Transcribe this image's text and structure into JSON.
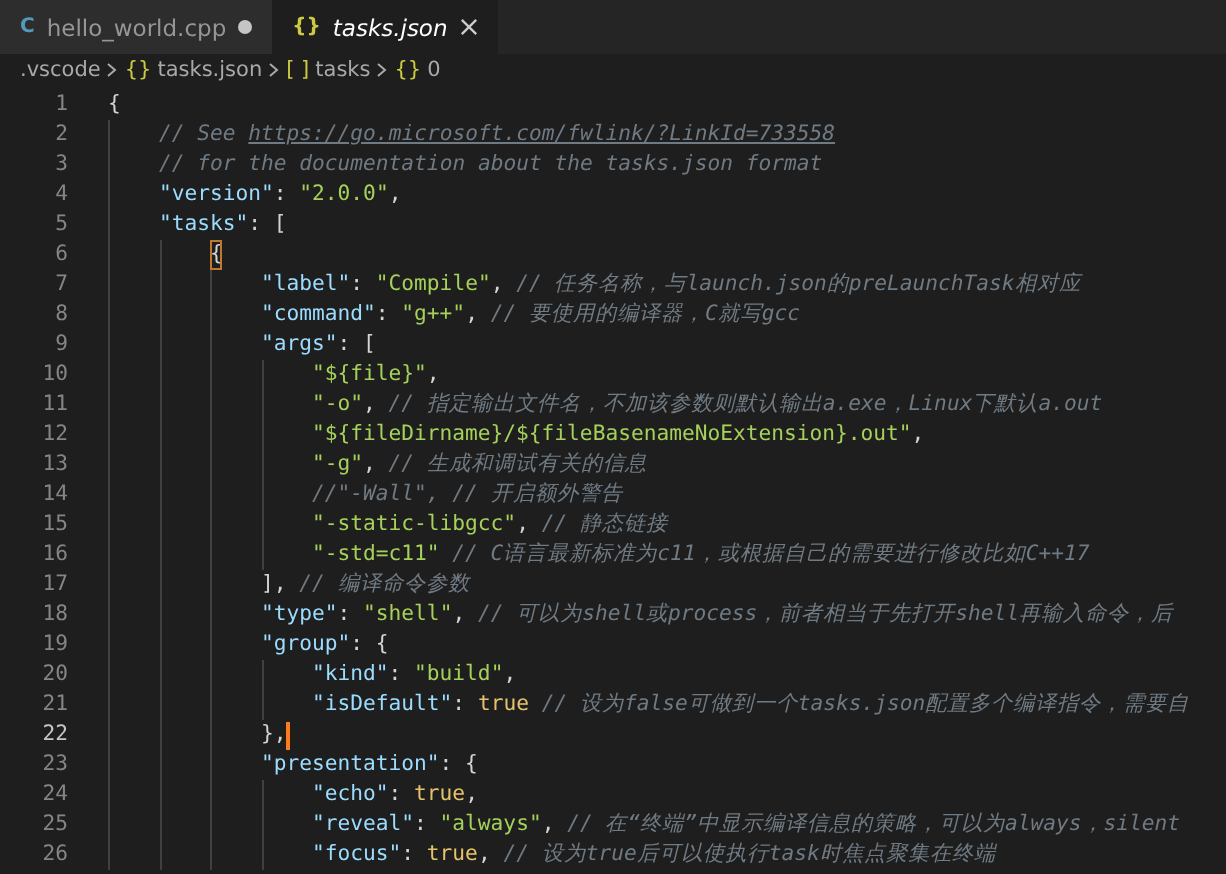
{
  "tabs": [
    {
      "icon": "C",
      "label": "hello_world.cpp",
      "selected": false,
      "modified": true
    },
    {
      "icon": "{}",
      "label": "tasks.json",
      "selected": true,
      "modified": false
    }
  ],
  "breadcrumbs": [
    {
      "label": ".vscode"
    },
    {
      "icon": "{}",
      "label": "tasks.json"
    },
    {
      "icon": "[ ]",
      "label": "tasks"
    },
    {
      "icon": "{}",
      "label": "0"
    }
  ],
  "lines": [
    {
      "number": "1",
      "current": false,
      "tokens": [
        {
          "kind": "punct",
          "text": "{"
        }
      ],
      "children": [
        {
          "number": "2",
          "current": false,
          "tokens": [
            {
              "kind": "comment",
              "text": "// See "
            },
            {
              "kind": "link",
              "text": "https://go.microsoft.com/fwlink/?LinkId=733558"
            }
          ]
        },
        {
          "number": "3",
          "current": false,
          "tokens": [
            {
              "kind": "comment",
              "text": "// for the documentation about the tasks.json format"
            }
          ]
        },
        {
          "number": "4",
          "current": false,
          "tokens": [
            {
              "kind": "key",
              "text": "\"version\""
            },
            {
              "kind": "punct",
              "text": ": "
            },
            {
              "kind": "string",
              "text": "\"2.0.0\""
            },
            {
              "kind": "punct",
              "text": ","
            }
          ]
        },
        {
          "number": "5",
          "current": false,
          "tokens": [
            {
              "kind": "key",
              "text": "\"tasks\""
            },
            {
              "kind": "punct",
              "text": ": ["
            }
          ],
          "children": [
            {
              "number": "6",
              "current": false,
              "tokens": [
                {
                  "kind": "bracket",
                  "text": "{"
                }
              ],
              "children": [
                {
                  "number": "7",
                  "current": false,
                  "tokens": [
                    {
                      "kind": "key",
                      "text": "\"label\""
                    },
                    {
                      "kind": "punct",
                      "text": ": "
                    },
                    {
                      "kind": "string",
                      "text": "\"Compile\""
                    },
                    {
                      "kind": "punct",
                      "text": ", "
                    },
                    {
                      "kind": "comment",
                      "text": "// 任务名称，与launch.json的preLaunchTask相对应"
                    }
                  ]
                },
                {
                  "number": "8",
                  "current": false,
                  "tokens": [
                    {
                      "kind": "key",
                      "text": "\"command\""
                    },
                    {
                      "kind": "punct",
                      "text": ": "
                    },
                    {
                      "kind": "string",
                      "text": "\"g++\""
                    },
                    {
                      "kind": "punct",
                      "text": ", "
                    },
                    {
                      "kind": "comment",
                      "text": "// 要使用的编译器，C就写gcc"
                    }
                  ]
                },
                {
                  "number": "9",
                  "current": false,
                  "tokens": [
                    {
                      "kind": "key",
                      "text": "\"args\""
                    },
                    {
                      "kind": "punct",
                      "text": ": ["
                    }
                  ],
                  "children": [
                    {
                      "number": "10",
                      "current": false,
                      "tokens": [
                        {
                          "kind": "string",
                          "text": "\"${file}\""
                        },
                        {
                          "kind": "punct",
                          "text": ","
                        }
                      ]
                    },
                    {
                      "number": "11",
                      "current": false,
                      "tokens": [
                        {
                          "kind": "string",
                          "text": "\"-o\""
                        },
                        {
                          "kind": "punct",
                          "text": ", "
                        },
                        {
                          "kind": "comment",
                          "text": "// 指定输出文件名，不加该参数则默认输出a.exe，Linux下默认a.out"
                        }
                      ]
                    },
                    {
                      "number": "12",
                      "current": false,
                      "tokens": [
                        {
                          "kind": "string",
                          "text": "\"${fileDirname}/${fileBasenameNoExtension}.out\""
                        },
                        {
                          "kind": "punct",
                          "text": ","
                        }
                      ]
                    },
                    {
                      "number": "13",
                      "current": false,
                      "tokens": [
                        {
                          "kind": "string",
                          "text": "\"-g\""
                        },
                        {
                          "kind": "punct",
                          "text": ", "
                        },
                        {
                          "kind": "comment",
                          "text": "// 生成和调试有关的信息"
                        }
                      ]
                    },
                    {
                      "number": "14",
                      "current": false,
                      "tokens": [
                        {
                          "kind": "comment",
                          "text": "//\"-Wall\", // 开启额外警告"
                        }
                      ]
                    },
                    {
                      "number": "15",
                      "current": false,
                      "tokens": [
                        {
                          "kind": "string",
                          "text": "\"-static-libgcc\""
                        },
                        {
                          "kind": "punct",
                          "text": ", "
                        },
                        {
                          "kind": "comment",
                          "text": "// 静态链接"
                        }
                      ]
                    },
                    {
                      "number": "16",
                      "current": false,
                      "tokens": [
                        {
                          "kind": "string",
                          "text": "\"-std=c11\""
                        },
                        {
                          "kind": "space"
                        },
                        {
                          "kind": "comment",
                          "text": "// C语言最新标准为c11，或根据自己的需要进行修改比如C++17"
                        }
                      ]
                    }
                  ]
                },
                {
                  "number": "17",
                  "current": false,
                  "tokens": [
                    {
                      "kind": "punct",
                      "text": "], "
                    },
                    {
                      "kind": "comment",
                      "text": "// 编译命令参数"
                    }
                  ]
                },
                {
                  "number": "18",
                  "current": false,
                  "tokens": [
                    {
                      "kind": "key",
                      "text": "\"type\""
                    },
                    {
                      "kind": "punct",
                      "text": ": "
                    },
                    {
                      "kind": "string",
                      "text": "\"shell\""
                    },
                    {
                      "kind": "punct",
                      "text": ", "
                    },
                    {
                      "kind": "comment",
                      "text": "// 可以为shell或process，前者相当于先打开shell再输入命令，后"
                    }
                  ]
                },
                {
                  "number": "19",
                  "current": false,
                  "tokens": [
                    {
                      "kind": "key",
                      "text": "\"group\""
                    },
                    {
                      "kind": "punct",
                      "text": ": {"
                    }
                  ],
                  "children": [
                    {
                      "number": "20",
                      "current": false,
                      "tokens": [
                        {
                          "kind": "key",
                          "text": "\"kind\""
                        },
                        {
                          "kind": "punct",
                          "text": ": "
                        },
                        {
                          "kind": "string",
                          "text": "\"build\""
                        },
                        {
                          "kind": "punct",
                          "text": ","
                        }
                      ]
                    },
                    {
                      "number": "21",
                      "current": false,
                      "tokens": [
                        {
                          "kind": "key",
                          "text": "\"isDefault\""
                        },
                        {
                          "kind": "punct",
                          "text": ": "
                        },
                        {
                          "kind": "bool",
                          "text": "true"
                        },
                        {
                          "kind": "space"
                        },
                        {
                          "kind": "comment",
                          "text": "// 设为false可做到一个tasks.json配置多个编译指令，需要自"
                        }
                      ]
                    }
                  ]
                },
                {
                  "number": "22",
                  "current": true,
                  "tokens": [
                    {
                      "kind": "punct",
                      "text": "},"
                    }
                  ]
                },
                {
                  "number": "23",
                  "current": false,
                  "tokens": [
                    {
                      "kind": "key",
                      "text": "\"presentation\""
                    },
                    {
                      "kind": "punct",
                      "text": ": {"
                    }
                  ],
                  "children": [
                    {
                      "number": "24",
                      "current": false,
                      "tokens": [
                        {
                          "kind": "key",
                          "text": "\"echo\""
                        },
                        {
                          "kind": "punct",
                          "text": ": "
                        },
                        {
                          "kind": "bool",
                          "text": "true"
                        },
                        {
                          "kind": "punct",
                          "text": ","
                        }
                      ]
                    },
                    {
                      "number": "25",
                      "current": false,
                      "tokens": [
                        {
                          "kind": "key",
                          "text": "\"reveal\""
                        },
                        {
                          "kind": "punct",
                          "text": ": "
                        },
                        {
                          "kind": "string",
                          "text": "\"always\""
                        },
                        {
                          "kind": "punct",
                          "text": ", "
                        },
                        {
                          "kind": "comment",
                          "text": "// 在“终端”中显示编译信息的策略，可以为always，silent"
                        }
                      ]
                    },
                    {
                      "number": "26",
                      "current": false,
                      "tokens": [
                        {
                          "kind": "key",
                          "text": "\"focus\""
                        },
                        {
                          "kind": "punct",
                          "text": ": "
                        },
                        {
                          "kind": "bool",
                          "text": "true"
                        },
                        {
                          "kind": "punct",
                          "text": ", "
                        },
                        {
                          "kind": "comment",
                          "text": "// 设为true后可以使执行task时焦点聚集在终端"
                        }
                      ]
                    }
                  ]
                }
              ]
            }
          ]
        }
      ]
    }
  ]
}
